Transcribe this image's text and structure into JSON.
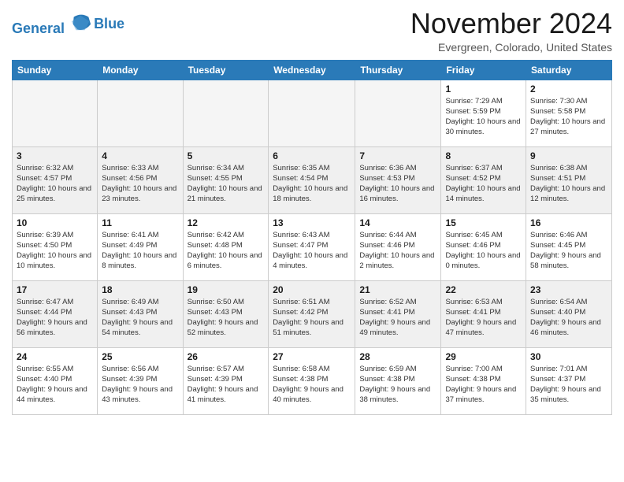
{
  "logo": {
    "line1": "General",
    "line2": "Blue"
  },
  "title": "November 2024",
  "location": "Evergreen, Colorado, United States",
  "days_of_week": [
    "Sunday",
    "Monday",
    "Tuesday",
    "Wednesday",
    "Thursday",
    "Friday",
    "Saturday"
  ],
  "weeks": [
    [
      {
        "day": "",
        "empty": true
      },
      {
        "day": "",
        "empty": true
      },
      {
        "day": "",
        "empty": true
      },
      {
        "day": "",
        "empty": true
      },
      {
        "day": "",
        "empty": true
      },
      {
        "day": "1",
        "sunrise": "Sunrise: 7:29 AM",
        "sunset": "Sunset: 5:59 PM",
        "daylight": "Daylight: 10 hours and 30 minutes."
      },
      {
        "day": "2",
        "sunrise": "Sunrise: 7:30 AM",
        "sunset": "Sunset: 5:58 PM",
        "daylight": "Daylight: 10 hours and 27 minutes."
      }
    ],
    [
      {
        "day": "3",
        "sunrise": "Sunrise: 6:32 AM",
        "sunset": "Sunset: 4:57 PM",
        "daylight": "Daylight: 10 hours and 25 minutes."
      },
      {
        "day": "4",
        "sunrise": "Sunrise: 6:33 AM",
        "sunset": "Sunset: 4:56 PM",
        "daylight": "Daylight: 10 hours and 23 minutes."
      },
      {
        "day": "5",
        "sunrise": "Sunrise: 6:34 AM",
        "sunset": "Sunset: 4:55 PM",
        "daylight": "Daylight: 10 hours and 21 minutes."
      },
      {
        "day": "6",
        "sunrise": "Sunrise: 6:35 AM",
        "sunset": "Sunset: 4:54 PM",
        "daylight": "Daylight: 10 hours and 18 minutes."
      },
      {
        "day": "7",
        "sunrise": "Sunrise: 6:36 AM",
        "sunset": "Sunset: 4:53 PM",
        "daylight": "Daylight: 10 hours and 16 minutes."
      },
      {
        "day": "8",
        "sunrise": "Sunrise: 6:37 AM",
        "sunset": "Sunset: 4:52 PM",
        "daylight": "Daylight: 10 hours and 14 minutes."
      },
      {
        "day": "9",
        "sunrise": "Sunrise: 6:38 AM",
        "sunset": "Sunset: 4:51 PM",
        "daylight": "Daylight: 10 hours and 12 minutes."
      }
    ],
    [
      {
        "day": "10",
        "sunrise": "Sunrise: 6:39 AM",
        "sunset": "Sunset: 4:50 PM",
        "daylight": "Daylight: 10 hours and 10 minutes."
      },
      {
        "day": "11",
        "sunrise": "Sunrise: 6:41 AM",
        "sunset": "Sunset: 4:49 PM",
        "daylight": "Daylight: 10 hours and 8 minutes."
      },
      {
        "day": "12",
        "sunrise": "Sunrise: 6:42 AM",
        "sunset": "Sunset: 4:48 PM",
        "daylight": "Daylight: 10 hours and 6 minutes."
      },
      {
        "day": "13",
        "sunrise": "Sunrise: 6:43 AM",
        "sunset": "Sunset: 4:47 PM",
        "daylight": "Daylight: 10 hours and 4 minutes."
      },
      {
        "day": "14",
        "sunrise": "Sunrise: 6:44 AM",
        "sunset": "Sunset: 4:46 PM",
        "daylight": "Daylight: 10 hours and 2 minutes."
      },
      {
        "day": "15",
        "sunrise": "Sunrise: 6:45 AM",
        "sunset": "Sunset: 4:46 PM",
        "daylight": "Daylight: 10 hours and 0 minutes."
      },
      {
        "day": "16",
        "sunrise": "Sunrise: 6:46 AM",
        "sunset": "Sunset: 4:45 PM",
        "daylight": "Daylight: 9 hours and 58 minutes."
      }
    ],
    [
      {
        "day": "17",
        "sunrise": "Sunrise: 6:47 AM",
        "sunset": "Sunset: 4:44 PM",
        "daylight": "Daylight: 9 hours and 56 minutes."
      },
      {
        "day": "18",
        "sunrise": "Sunrise: 6:49 AM",
        "sunset": "Sunset: 4:43 PM",
        "daylight": "Daylight: 9 hours and 54 minutes."
      },
      {
        "day": "19",
        "sunrise": "Sunrise: 6:50 AM",
        "sunset": "Sunset: 4:43 PM",
        "daylight": "Daylight: 9 hours and 52 minutes."
      },
      {
        "day": "20",
        "sunrise": "Sunrise: 6:51 AM",
        "sunset": "Sunset: 4:42 PM",
        "daylight": "Daylight: 9 hours and 51 minutes."
      },
      {
        "day": "21",
        "sunrise": "Sunrise: 6:52 AM",
        "sunset": "Sunset: 4:41 PM",
        "daylight": "Daylight: 9 hours and 49 minutes."
      },
      {
        "day": "22",
        "sunrise": "Sunrise: 6:53 AM",
        "sunset": "Sunset: 4:41 PM",
        "daylight": "Daylight: 9 hours and 47 minutes."
      },
      {
        "day": "23",
        "sunrise": "Sunrise: 6:54 AM",
        "sunset": "Sunset: 4:40 PM",
        "daylight": "Daylight: 9 hours and 46 minutes."
      }
    ],
    [
      {
        "day": "24",
        "sunrise": "Sunrise: 6:55 AM",
        "sunset": "Sunset: 4:40 PM",
        "daylight": "Daylight: 9 hours and 44 minutes."
      },
      {
        "day": "25",
        "sunrise": "Sunrise: 6:56 AM",
        "sunset": "Sunset: 4:39 PM",
        "daylight": "Daylight: 9 hours and 43 minutes."
      },
      {
        "day": "26",
        "sunrise": "Sunrise: 6:57 AM",
        "sunset": "Sunset: 4:39 PM",
        "daylight": "Daylight: 9 hours and 41 minutes."
      },
      {
        "day": "27",
        "sunrise": "Sunrise: 6:58 AM",
        "sunset": "Sunset: 4:38 PM",
        "daylight": "Daylight: 9 hours and 40 minutes."
      },
      {
        "day": "28",
        "sunrise": "Sunrise: 6:59 AM",
        "sunset": "Sunset: 4:38 PM",
        "daylight": "Daylight: 9 hours and 38 minutes."
      },
      {
        "day": "29",
        "sunrise": "Sunrise: 7:00 AM",
        "sunset": "Sunset: 4:38 PM",
        "daylight": "Daylight: 9 hours and 37 minutes."
      },
      {
        "day": "30",
        "sunrise": "Sunrise: 7:01 AM",
        "sunset": "Sunset: 4:37 PM",
        "daylight": "Daylight: 9 hours and 35 minutes."
      }
    ]
  ]
}
